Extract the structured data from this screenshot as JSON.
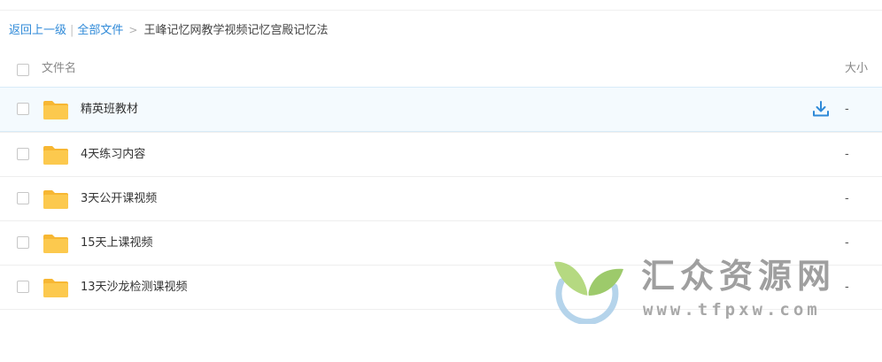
{
  "breadcrumb": {
    "back_label": "返回上一级",
    "separator": "|",
    "all_files_label": "全部文件",
    "arrow": ">",
    "current_folder": "王峰记忆网教学视频记忆宫殿记忆法"
  },
  "list_header": {
    "name_label": "文件名",
    "size_label": "大小"
  },
  "files": [
    {
      "name": "精英班教材",
      "size": "-",
      "type": "folder",
      "hovered": true
    },
    {
      "name": "4天练习内容",
      "size": "-",
      "type": "folder"
    },
    {
      "name": "3天公开课视频",
      "size": "-",
      "type": "folder"
    },
    {
      "name": "15天上课视频",
      "size": "-",
      "type": "folder"
    },
    {
      "name": "13天沙龙检测课视频",
      "size": "-",
      "type": "folder"
    }
  ],
  "colors": {
    "link": "#2f8ad8",
    "folder": "#fcc94e",
    "folder_tab": "#f7b733",
    "download_icon": "#2f8ad8",
    "hover_row": "#f4fafe"
  },
  "icons": {
    "folder": "folder-icon",
    "download": "download-icon",
    "watermark_logo": "leaf-logo-icon"
  },
  "watermark": {
    "title": "汇众资源网",
    "url": "www.tfpxw.com"
  }
}
